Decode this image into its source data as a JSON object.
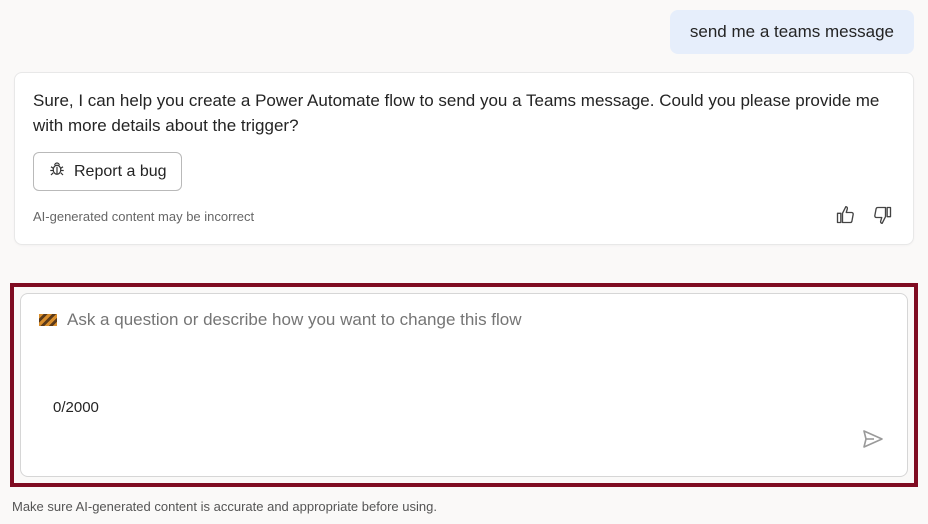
{
  "chat": {
    "user_message": "send me a teams message",
    "assistant_message": "Sure, I can help you create a Power Automate flow to send you a Teams message. Could you please provide me with more details about the trigger?",
    "report_label": "Report a bug",
    "disclaimer": "AI-generated content may be incorrect"
  },
  "input": {
    "placeholder": "Ask a question or describe how you want to change this flow",
    "char_count": "0/2000"
  },
  "footer": {
    "note": "Make sure AI-generated content is accurate and appropriate before using."
  }
}
